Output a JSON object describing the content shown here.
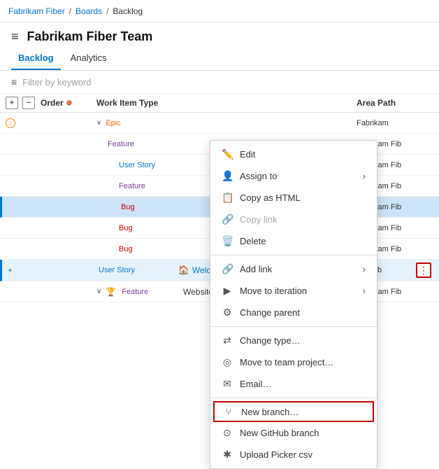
{
  "breadcrumb": {
    "items": [
      "Fabrikam Fiber",
      "Boards",
      "Backlog"
    ],
    "separators": [
      "/",
      "/"
    ]
  },
  "header": {
    "hamburger": "≡",
    "team_title": "Fabrikam Fiber Team"
  },
  "tabs": [
    {
      "label": "Backlog",
      "active": true
    },
    {
      "label": "Analytics",
      "active": false
    }
  ],
  "filter": {
    "placeholder": "Filter by keyword"
  },
  "table": {
    "headers": {
      "order": "Order",
      "wit": "Work Item Type",
      "area": "Area Path"
    },
    "rows": [
      {
        "id": 1,
        "indent": 0,
        "has_chevron": true,
        "chevron": "∨",
        "wit": "Epic",
        "wit_class": "wit-epic",
        "title": "",
        "title_plain": true,
        "area": "Fabrikam",
        "circle": true
      },
      {
        "id": 2,
        "indent": 1,
        "has_chevron": false,
        "wit": "Feature",
        "wit_class": "wit-feature",
        "title": "",
        "area": "Fabrikam Fib",
        "circle": false
      },
      {
        "id": 3,
        "indent": 2,
        "has_chevron": false,
        "wit": "User Story",
        "wit_class": "wit-story",
        "title": "",
        "area": "Fabrikam Fib",
        "circle": false
      },
      {
        "id": 4,
        "indent": 2,
        "has_chevron": false,
        "wit": "Feature",
        "wit_class": "wit-feature",
        "title": "",
        "area": "Fabrikam Fib",
        "circle": false
      },
      {
        "id": 5,
        "indent": 2,
        "has_chevron": false,
        "wit": "Bug",
        "wit_class": "wit-bug",
        "title": "",
        "area": "Fabrikam Fib",
        "highlighted": true,
        "circle": false
      },
      {
        "id": 6,
        "indent": 2,
        "has_chevron": false,
        "wit": "Bug",
        "wit_class": "wit-bug",
        "title": "",
        "area": "Fabrikam Fib",
        "circle": false
      },
      {
        "id": 7,
        "indent": 2,
        "has_chevron": false,
        "wit": "Bug",
        "wit_class": "wit-bug",
        "title": "",
        "area": "Fabrikam Fib",
        "circle": false
      },
      {
        "id": 8,
        "indent": 0,
        "has_chevron": false,
        "wit": "User Story",
        "wit_class": "wit-story",
        "title": "Welcome back page im...",
        "title_link": true,
        "area": "Fabrikam Fib",
        "has_plus": true,
        "has_actions": true,
        "selected": true
      },
      {
        "id": 9,
        "indent": 0,
        "has_chevron": true,
        "chevron": "∨",
        "wit": "Feature",
        "wit_class": "wit-feature",
        "title": "Website improvements",
        "title_plain": true,
        "area": "Fabrikam Fib",
        "circle": false
      }
    ]
  },
  "context_menu": {
    "items": [
      {
        "id": "edit",
        "label": "Edit",
        "icon": "✏️",
        "has_arrow": false,
        "disabled": false
      },
      {
        "id": "assign-to",
        "label": "Assign to",
        "icon": "👤",
        "has_arrow": true,
        "disabled": false
      },
      {
        "id": "copy-html",
        "label": "Copy as HTML",
        "icon": "📋",
        "has_arrow": false,
        "disabled": false
      },
      {
        "id": "copy-link",
        "label": "Copy link",
        "icon": "🔗",
        "has_arrow": false,
        "disabled": true
      },
      {
        "id": "delete",
        "label": "Delete",
        "icon": "🗑️",
        "has_arrow": false,
        "disabled": false
      },
      {
        "id": "divider1"
      },
      {
        "id": "add-link",
        "label": "Add link",
        "icon": "🔗",
        "has_arrow": true,
        "disabled": false
      },
      {
        "id": "move-iteration",
        "label": "Move to iteration",
        "icon": "▶",
        "has_arrow": true,
        "disabled": false
      },
      {
        "id": "change-parent",
        "label": "Change parent",
        "icon": "⚙",
        "has_arrow": false,
        "disabled": false
      },
      {
        "id": "divider2"
      },
      {
        "id": "change-type",
        "label": "Change type…",
        "icon": "⇄",
        "has_arrow": false,
        "disabled": false
      },
      {
        "id": "move-project",
        "label": "Move to team project…",
        "icon": "◎",
        "has_arrow": false,
        "disabled": false
      },
      {
        "id": "email",
        "label": "Email…",
        "icon": "✉",
        "has_arrow": false,
        "disabled": false
      },
      {
        "id": "divider3"
      },
      {
        "id": "new-branch",
        "label": "New branch…",
        "icon": "⑂",
        "has_arrow": false,
        "disabled": false,
        "highlighted": true
      },
      {
        "id": "new-github",
        "label": "New GitHub branch",
        "icon": "⊙",
        "has_arrow": false,
        "disabled": false
      },
      {
        "id": "upload-picker",
        "label": "Upload Picker csv",
        "icon": "✱",
        "has_arrow": false,
        "disabled": false
      }
    ]
  },
  "colors": {
    "accent": "#0078d4",
    "danger": "#cc0000",
    "border": "#e0e0e0"
  }
}
